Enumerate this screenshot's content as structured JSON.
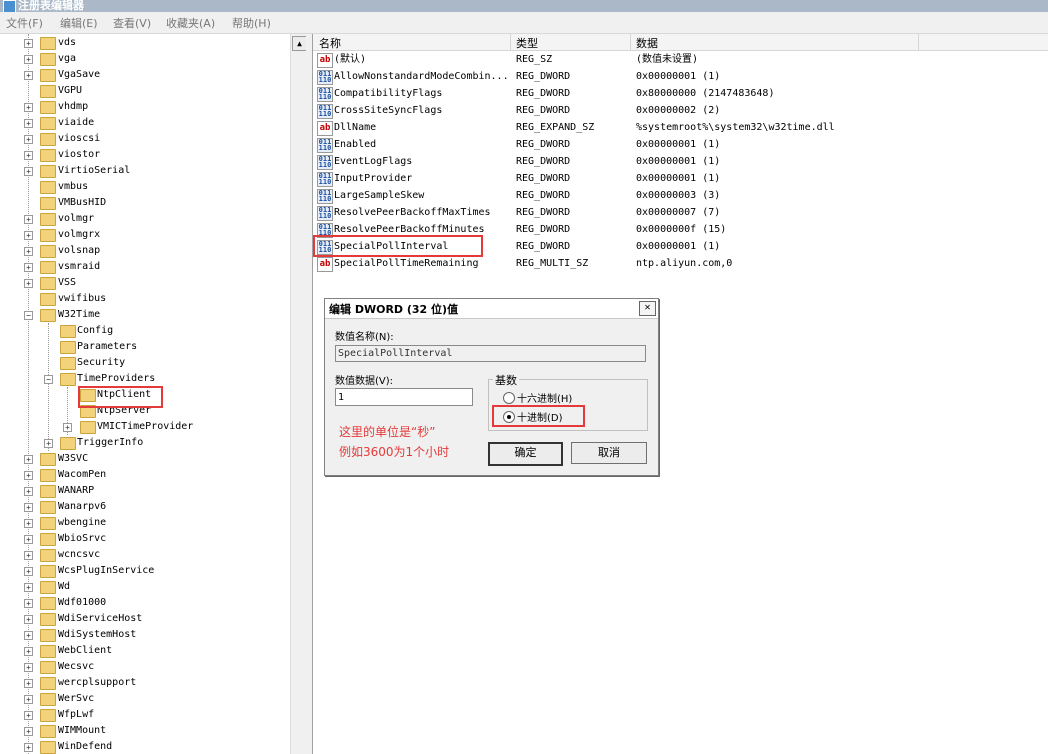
{
  "window": {
    "title": "注册表编辑器"
  },
  "menu": [
    "文件(F)",
    "编辑(E)",
    "查看(V)",
    "收藏夹(A)",
    "帮助(H)"
  ],
  "tree": {
    "items": [
      {
        "label": "vds",
        "level": 0,
        "exp": "+"
      },
      {
        "label": "vga",
        "level": 0,
        "exp": "+"
      },
      {
        "label": "VgaSave",
        "level": 0,
        "exp": "+"
      },
      {
        "label": "VGPU",
        "level": 0,
        "exp": ""
      },
      {
        "label": "vhdmp",
        "level": 0,
        "exp": "+"
      },
      {
        "label": "viaide",
        "level": 0,
        "exp": "+"
      },
      {
        "label": "vioscsi",
        "level": 0,
        "exp": "+"
      },
      {
        "label": "viostor",
        "level": 0,
        "exp": "+"
      },
      {
        "label": "VirtioSerial",
        "level": 0,
        "exp": "+"
      },
      {
        "label": "vmbus",
        "level": 0,
        "exp": ""
      },
      {
        "label": "VMBusHID",
        "level": 0,
        "exp": ""
      },
      {
        "label": "volmgr",
        "level": 0,
        "exp": "+"
      },
      {
        "label": "volmgrx",
        "level": 0,
        "exp": "+"
      },
      {
        "label": "volsnap",
        "level": 0,
        "exp": "+"
      },
      {
        "label": "vsmraid",
        "level": 0,
        "exp": "+"
      },
      {
        "label": "VSS",
        "level": 0,
        "exp": "+"
      },
      {
        "label": "vwifibus",
        "level": 0,
        "exp": ""
      },
      {
        "label": "W32Time",
        "level": 0,
        "exp": "-"
      },
      {
        "label": "Config",
        "level": 1,
        "exp": ""
      },
      {
        "label": "Parameters",
        "level": 1,
        "exp": ""
      },
      {
        "label": "Security",
        "level": 1,
        "exp": ""
      },
      {
        "label": "TimeProviders",
        "level": 1,
        "exp": "-"
      },
      {
        "label": "NtpClient",
        "level": 2,
        "exp": ""
      },
      {
        "label": "NtpServer",
        "level": 2,
        "exp": ""
      },
      {
        "label": "VMICTimeProvider",
        "level": 2,
        "exp": "+"
      },
      {
        "label": "TriggerInfo",
        "level": 1,
        "exp": "+"
      },
      {
        "label": "W3SVC",
        "level": 0,
        "exp": "+"
      },
      {
        "label": "WacomPen",
        "level": 0,
        "exp": "+"
      },
      {
        "label": "WANARP",
        "level": 0,
        "exp": "+"
      },
      {
        "label": "Wanarpv6",
        "level": 0,
        "exp": "+"
      },
      {
        "label": "wbengine",
        "level": 0,
        "exp": "+"
      },
      {
        "label": "WbioSrvc",
        "level": 0,
        "exp": "+"
      },
      {
        "label": "wcncsvc",
        "level": 0,
        "exp": "+"
      },
      {
        "label": "WcsPlugInService",
        "level": 0,
        "exp": "+"
      },
      {
        "label": "Wd",
        "level": 0,
        "exp": "+"
      },
      {
        "label": "Wdf01000",
        "level": 0,
        "exp": "+"
      },
      {
        "label": "WdiServiceHost",
        "level": 0,
        "exp": "+"
      },
      {
        "label": "WdiSystemHost",
        "level": 0,
        "exp": "+"
      },
      {
        "label": "WebClient",
        "level": 0,
        "exp": "+"
      },
      {
        "label": "Wecsvc",
        "level": 0,
        "exp": "+"
      },
      {
        "label": "wercplsupport",
        "level": 0,
        "exp": "+"
      },
      {
        "label": "WerSvc",
        "level": 0,
        "exp": "+"
      },
      {
        "label": "WfpLwf",
        "level": 0,
        "exp": "+"
      },
      {
        "label": "WIMMount",
        "level": 0,
        "exp": "+"
      },
      {
        "label": "WinDefend",
        "level": 0,
        "exp": "+"
      }
    ]
  },
  "list": {
    "headers": {
      "name": "名称",
      "type": "类型",
      "data": "数据"
    },
    "rows": [
      {
        "icon": "string-value-icon",
        "name": "(默认)",
        "type": "REG_SZ",
        "data": "(数值未设置)"
      },
      {
        "icon": "dword-value-icon",
        "name": "AllowNonstandardModeCombin...",
        "type": "REG_DWORD",
        "data": "0x00000001 (1)"
      },
      {
        "icon": "dword-value-icon",
        "name": "CompatibilityFlags",
        "type": "REG_DWORD",
        "data": "0x80000000 (2147483648)"
      },
      {
        "icon": "dword-value-icon",
        "name": "CrossSiteSyncFlags",
        "type": "REG_DWORD",
        "data": "0x00000002 (2)"
      },
      {
        "icon": "string-value-icon",
        "name": "DllName",
        "type": "REG_EXPAND_SZ",
        "data": "%systemroot%\\system32\\w32time.dll"
      },
      {
        "icon": "dword-value-icon",
        "name": "Enabled",
        "type": "REG_DWORD",
        "data": "0x00000001 (1)"
      },
      {
        "icon": "dword-value-icon",
        "name": "EventLogFlags",
        "type": "REG_DWORD",
        "data": "0x00000001 (1)"
      },
      {
        "icon": "dword-value-icon",
        "name": "InputProvider",
        "type": "REG_DWORD",
        "data": "0x00000001 (1)"
      },
      {
        "icon": "dword-value-icon",
        "name": "LargeSampleSkew",
        "type": "REG_DWORD",
        "data": "0x00000003 (3)"
      },
      {
        "icon": "dword-value-icon",
        "name": "ResolvePeerBackoffMaxTimes",
        "type": "REG_DWORD",
        "data": "0x00000007 (7)"
      },
      {
        "icon": "dword-value-icon",
        "name": "ResolvePeerBackoffMinutes",
        "type": "REG_DWORD",
        "data": "0x0000000f (15)"
      },
      {
        "icon": "dword-value-icon",
        "name": "SpecialPollInterval",
        "type": "REG_DWORD",
        "data": "0x00000001 (1)"
      },
      {
        "icon": "string-value-icon",
        "name": "SpecialPollTimeRemaining",
        "type": "REG_MULTI_SZ",
        "data": "ntp.aliyun.com,0"
      }
    ]
  },
  "dialog": {
    "title": "编辑 DWORD (32 位)值",
    "name_label": "数值名称(N):",
    "name_value": "SpecialPollInterval",
    "data_label": "数值数据(V):",
    "data_value": "1",
    "base_label": "基数",
    "hex_label": "十六进制(H)",
    "dec_label": "十进制(D)",
    "ok_label": "确定",
    "cancel_label": "取消"
  },
  "annotation": {
    "line1": "这里的单位是“秒”",
    "line2": "例如3600为1个小时"
  },
  "colors": {
    "highlight": "#e53a3a"
  }
}
